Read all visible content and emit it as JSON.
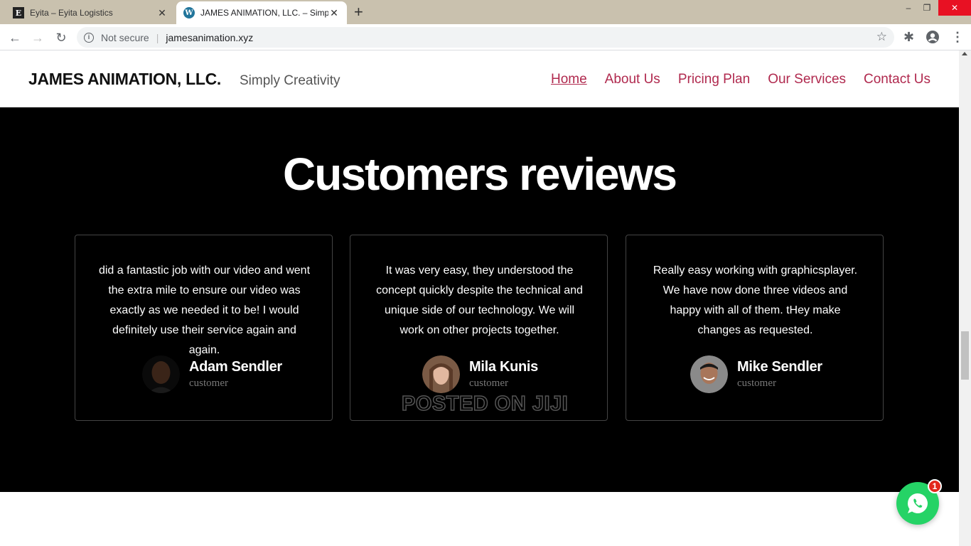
{
  "browser": {
    "tabs": [
      {
        "title": "Eyita – Eyita Logistics",
        "icon": "eyita-favicon",
        "active": false
      },
      {
        "title": "JAMES ANIMATION, LLC. – Simply Creativity",
        "icon": "wordpress-favicon",
        "active": true
      }
    ],
    "new_tab_label": "+",
    "window": {
      "minimize": "–",
      "maximize": "❐",
      "close": "✕"
    },
    "address": {
      "security": "Not secure",
      "url": "jamesanimation.xyz"
    }
  },
  "site": {
    "brand": "JAMES ANIMATION, LLC.",
    "tagline": "Simply Creativity",
    "menu": [
      {
        "label": "Home",
        "current": true
      },
      {
        "label": "About Us"
      },
      {
        "label": "Pricing Plan"
      },
      {
        "label": "Our Services"
      },
      {
        "label": "Contact Us"
      }
    ],
    "menu_color": "#b0294e"
  },
  "reviews": {
    "heading": "Customers reviews",
    "cards": [
      {
        "quote": "did a fantastic job with our video and went the extra mile to ensure our video was exactly as we needed it to be! I would definitely use their service again and again.",
        "name": "Adam Sendler",
        "role": "customer"
      },
      {
        "quote": "It was very easy, they understood the concept quickly despite the technical and unique side of our technology. We will work on other projects together.",
        "name": "Mila Kunis",
        "role": "customer"
      },
      {
        "quote": "Really easy working with graphicsplayer. We have now done three videos and happy with all of them. tHey make changes as requested.",
        "name": "Mike Sendler",
        "role": "customer"
      }
    ]
  },
  "watermark": "POSTED ON JIJI",
  "chat": {
    "badge_count": "1",
    "icon": "whatsapp-icon",
    "color": "#25d366"
  }
}
